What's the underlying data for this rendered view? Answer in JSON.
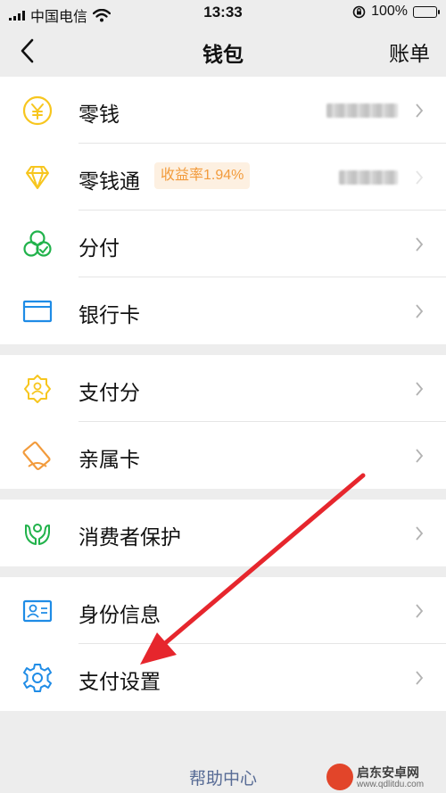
{
  "status_bar": {
    "carrier": "中国电信",
    "time": "13:33",
    "battery": "100%",
    "battery_level": 1.0
  },
  "nav": {
    "back_icon": "chevron-left-icon",
    "title": "钱包",
    "right_label": "账单"
  },
  "groups": [
    {
      "rows": [
        {
          "label": "零钱",
          "icon": "yen-coin-icon",
          "value_hidden": true
        },
        {
          "label": "零钱通",
          "icon": "diamond-icon",
          "badge": "收益率1.94%",
          "value_hidden": true
        },
        {
          "label": "分付",
          "icon": "clover-icon"
        },
        {
          "label": "银行卡",
          "icon": "bank-card-icon"
        }
      ]
    },
    {
      "rows": [
        {
          "label": "支付分",
          "icon": "score-badge-icon"
        },
        {
          "label": "亲属卡",
          "icon": "family-card-icon"
        }
      ]
    },
    {
      "rows": [
        {
          "label": "消费者保护",
          "icon": "protect-hands-icon"
        }
      ]
    },
    {
      "rows": [
        {
          "label": "身份信息",
          "icon": "id-card-icon"
        },
        {
          "label": "支付设置",
          "icon": "gear-icon"
        }
      ]
    }
  ],
  "footer": {
    "help_label": "帮助中心"
  },
  "watermark": {
    "name": "启东安卓网",
    "url": "www.qdlitdu.com"
  },
  "colors": {
    "accent_yellow": "#f7c61f",
    "accent_green": "#21b24b",
    "accent_blue": "#1f8ce6",
    "accent_orange": "#f29b3c",
    "link_blue": "#576b95",
    "annotation_red": "#e6262d"
  }
}
